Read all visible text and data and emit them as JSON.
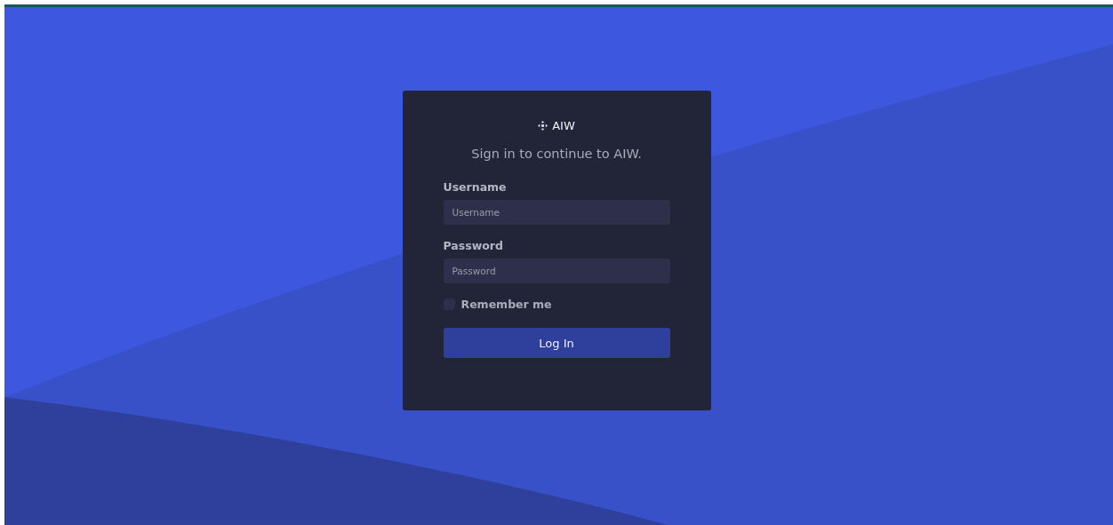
{
  "brand": {
    "name": "AIW"
  },
  "subtitle": "Sign in to continue to AIW.",
  "fields": [
    {
      "label": "Username",
      "placeholder": "Username"
    },
    {
      "label": "Password",
      "placeholder": "Password"
    }
  ],
  "remember": {
    "label": "Remember me",
    "checked": false
  },
  "submit": {
    "label": "Log In"
  }
}
